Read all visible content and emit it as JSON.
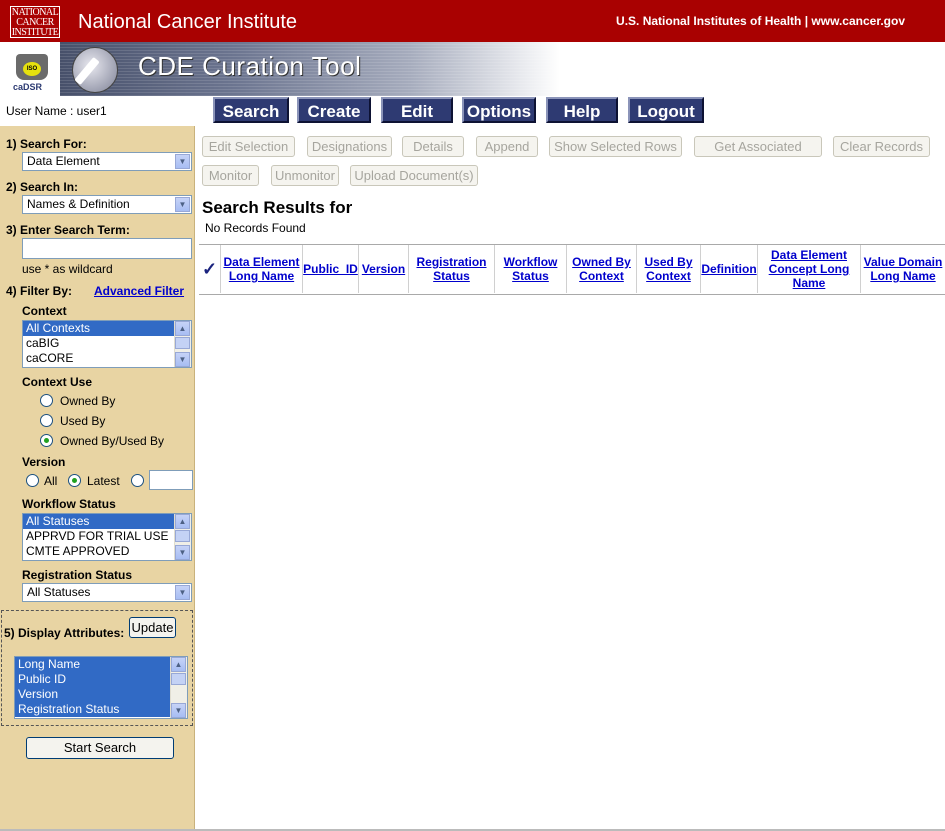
{
  "header": {
    "logo_lines": [
      "NATIONAL",
      "CANCER",
      "INSTITUTE"
    ],
    "title": "National Cancer Institute",
    "right_text": "U.S. National Institutes of Health  |  www.cancer.gov"
  },
  "banner": {
    "cadsr_logo": "caDSR",
    "badge": "ISO",
    "title": "CDE Curation Tool"
  },
  "user": {
    "label": "User Name : user1"
  },
  "menu": [
    "Search",
    "Create",
    "Edit",
    "Options",
    "Help",
    "Logout"
  ],
  "sidebar": {
    "search_for_label": "1) Search For:",
    "search_for_value": "Data Element",
    "search_in_label": "2) Search In:",
    "search_in_value": "Names & Definition",
    "search_term_label": "3) Enter Search Term:",
    "search_term_value": "",
    "wildcard_hint": "use * as wildcard",
    "filter_label": "4) Filter By:",
    "advanced_filter": "Advanced Filter",
    "context_label": "Context",
    "context_options": [
      "All Contexts",
      "caBIG",
      "caCORE"
    ],
    "context_use_label": "Context Use",
    "context_use_options": [
      "Owned By",
      "Used By",
      "Owned By/Used By"
    ],
    "context_use_selected": "Owned By/Used By",
    "version_label": "Version",
    "version_all": "All",
    "version_latest": "Latest",
    "version_selected": "Latest",
    "version_input_value": "",
    "workflow_label": "Workflow Status",
    "workflow_options": [
      "All Statuses",
      "APPRVD FOR TRIAL USE",
      "CMTE APPROVED"
    ],
    "registration_label": "Registration Status",
    "registration_value": "All Statuses",
    "display_label": "5) Display Attributes:",
    "update_button": "Update",
    "display_options": [
      "Long Name",
      "Public ID",
      "Version",
      "Registration Status"
    ],
    "start_search": "Start Search"
  },
  "actions_row1": [
    "Edit Selection",
    "Designations",
    "Details",
    "Append",
    "Show Selected Rows",
    "Get Associated",
    "Clear Records"
  ],
  "actions_row2": [
    "Monitor",
    "Unmonitor",
    "Upload Document(s)"
  ],
  "results": {
    "title": "Search Results for",
    "status": "No Records Found",
    "check_mark": "✓",
    "columns": [
      "Data Element Long Name",
      "Public_ID",
      "Version",
      "Registration Status",
      "Workflow Status",
      "Owned By Context",
      "Used By Context",
      "Definition",
      "Data Element Concept Long Name",
      "Value Domain Long Name"
    ]
  },
  "colors": {
    "header_red": "#a90101",
    "menu_blue": "#2e3a72",
    "sidebar_tan": "#e8d4a3",
    "link_blue": "#0000cc",
    "selection_blue": "#316ac5"
  }
}
